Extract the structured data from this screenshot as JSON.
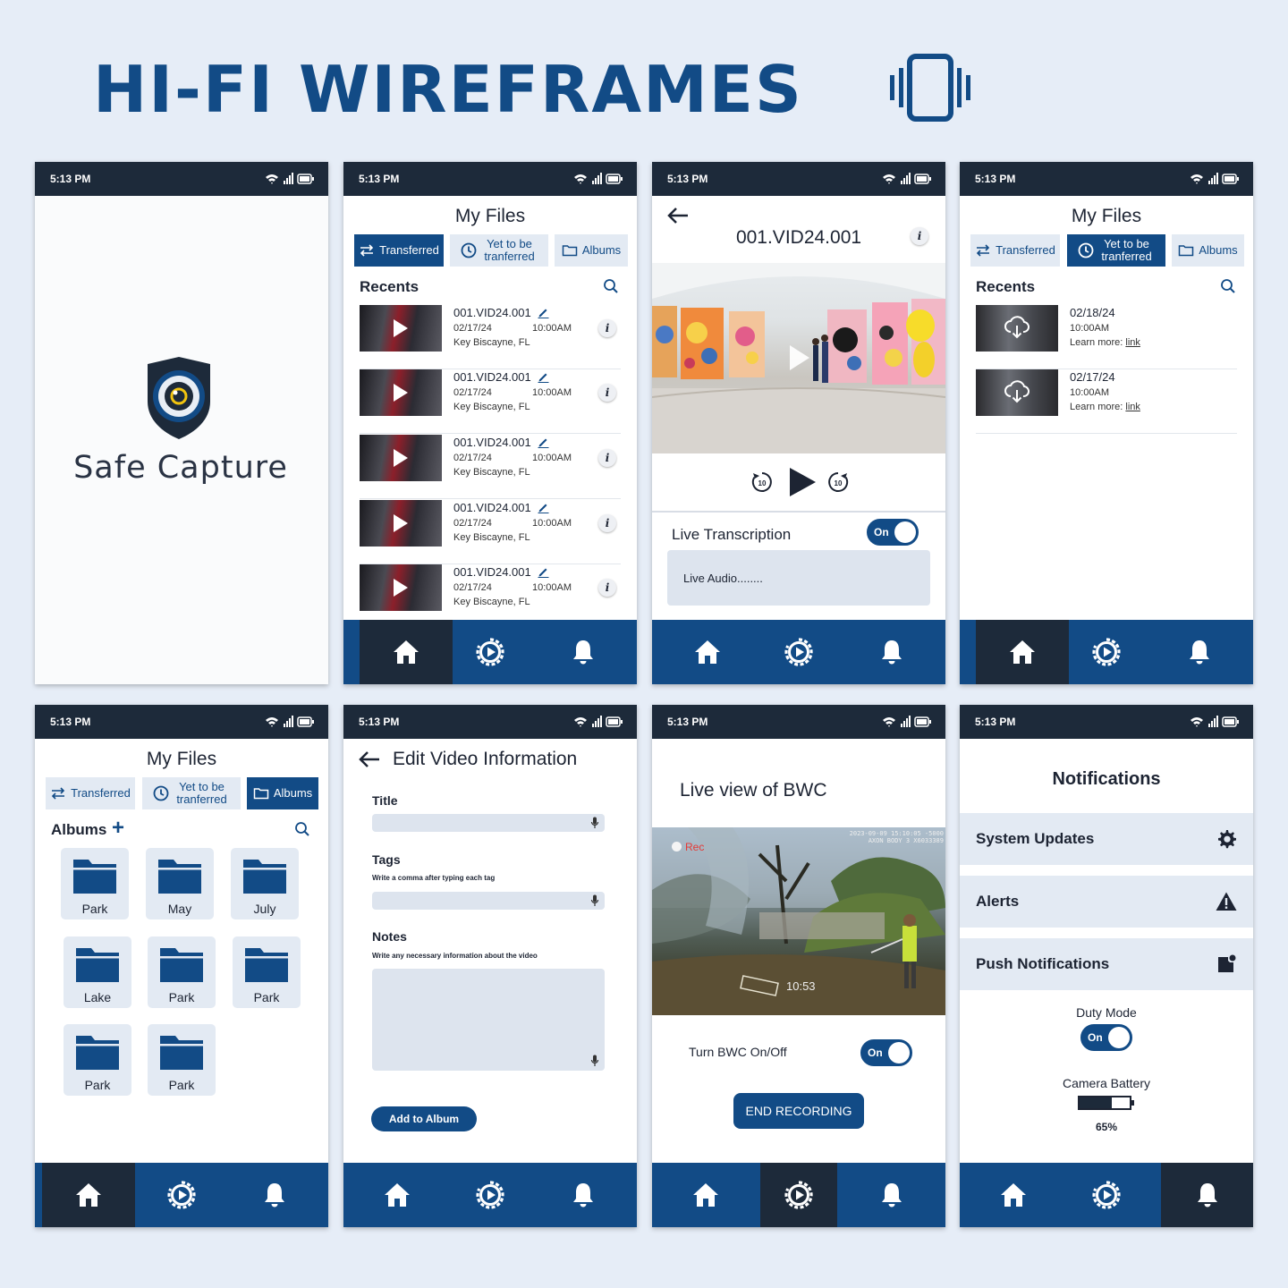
{
  "header": {
    "title": "HI-FI WIREFRAMES",
    "icon": "phone-vibrate-icon"
  },
  "status_time": "5:13 PM",
  "colors": {
    "primary": "#124b86",
    "dark": "#1d2a3a",
    "tab_bg": "#e3eaf3",
    "background": "#e6edf7",
    "rec_red": "#e53935"
  },
  "splash": {
    "app_name": "Safe Capture"
  },
  "files_screen": {
    "title": "My Files",
    "tabs": [
      {
        "label": "Transferred",
        "icon": "transfer-arrows-icon"
      },
      {
        "label": "Yet to be tranferred",
        "icon": "clock-icon"
      },
      {
        "label": "Albums",
        "icon": "folder-icon"
      }
    ],
    "recents_label": "Recents",
    "items": [
      {
        "name": "001.VID24.001",
        "date": "02/17/24",
        "time": "10:00AM",
        "location": "Key Biscayne, FL"
      },
      {
        "name": "001.VID24.001",
        "date": "02/17/24",
        "time": "10:00AM",
        "location": "Key Biscayne, FL"
      },
      {
        "name": "001.VID24.001",
        "date": "02/17/24",
        "time": "10:00AM",
        "location": "Key Biscayne, FL"
      },
      {
        "name": "001.VID24.001",
        "date": "02/17/24",
        "time": "10:00AM",
        "location": "Key Biscayne, FL"
      },
      {
        "name": "001.VID24.001",
        "date": "02/17/24",
        "time": "10:00AM",
        "location": "Key Biscayne, FL"
      }
    ],
    "info_glyph": "i"
  },
  "player_screen": {
    "title": "001.VID24.001",
    "info_glyph": "i",
    "skip_back": "10",
    "skip_forward": "10",
    "live_transcription_label": "Live Transcription",
    "toggle_label": "On",
    "transcript_text": "Live Audio........"
  },
  "pending_screen": {
    "title": "My Files",
    "recents_label": "Recents",
    "items": [
      {
        "date": "02/18/24",
        "time": "10:00AM",
        "learn_more": "Learn more:",
        "link": "link"
      },
      {
        "date": "02/17/24",
        "time": "10:00AM",
        "learn_more": "Learn more:",
        "link": "link"
      }
    ]
  },
  "albums_screen": {
    "title": "My Files",
    "albums_label": "Albums",
    "add_glyph": "+",
    "folders": [
      "Park",
      "May",
      "July",
      "Lake",
      "Park",
      "Park",
      "Park",
      "Park"
    ]
  },
  "edit_screen": {
    "title": "Edit Video Information",
    "title_label": "Title",
    "tags_label": "Tags",
    "tags_hint": "Write a comma after typing each tag",
    "notes_label": "Notes",
    "notes_hint": "Write any necessary information about the video",
    "add_album_button": "Add to Album"
  },
  "live_screen": {
    "title": "Live view of BWC",
    "rec_label": "Rec",
    "timestamp": "10:53",
    "overlay_text": "2023-09-09 15:10:05 -5000 AXON BODY 3 X6033389",
    "bwc_toggle_label": "Turn BWC On/Off",
    "toggle_label": "On",
    "end_button": "END RECORDING"
  },
  "notifications_screen": {
    "title": "Notifications",
    "rows": [
      {
        "label": "System Updates",
        "icon": "gear-icon"
      },
      {
        "label": "Alerts",
        "icon": "warning-icon"
      },
      {
        "label": "Push Notifications",
        "icon": "notification-badge-icon"
      }
    ],
    "duty_mode_label": "Duty Mode",
    "toggle_label": "On",
    "battery_label": "Camera Battery",
    "battery_level": 0.65,
    "battery_percent": "65%"
  }
}
